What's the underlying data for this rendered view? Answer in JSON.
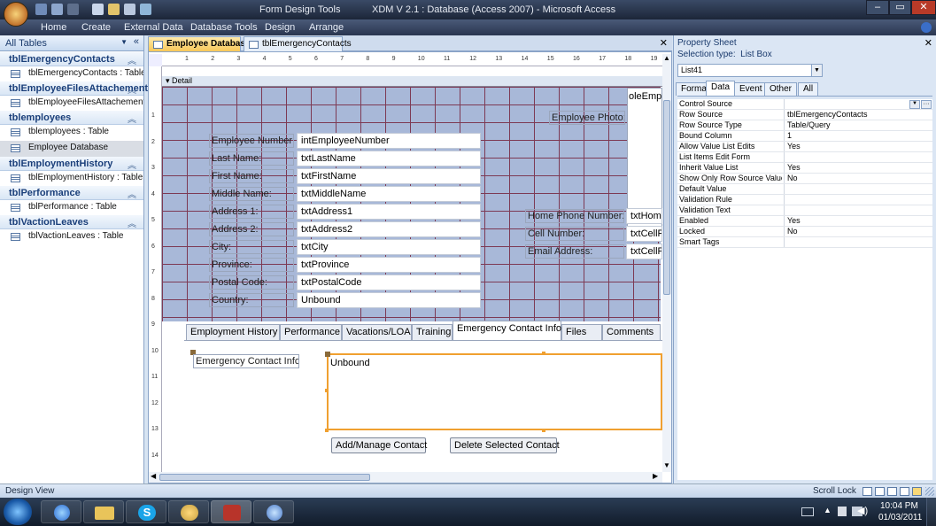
{
  "titlebar": {
    "context_title": "Form Design Tools",
    "title": "XDM V 2.1 : Database (Access 2007) - Microsoft Access",
    "min": "–",
    "max": "▭",
    "close": "✕"
  },
  "ribbon_tabs": [
    "Home",
    "Create",
    "External Data",
    "Database Tools",
    "Design",
    "Arrange"
  ],
  "nav": {
    "header": "All Tables",
    "groups": [
      {
        "name": "tblEmergencyContacts",
        "items": [
          "tblEmergencyContacts : Table"
        ]
      },
      {
        "name": "tblEmployeeFilesAttachement",
        "items": [
          "tblEmployeeFilesAttachement..."
        ]
      },
      {
        "name": "tblemployees",
        "items": [
          "tblemployees : Table",
          "Employee Database"
        ]
      },
      {
        "name": "tblEmploymentHistory",
        "items": [
          "tblEmploymentHistory : Table"
        ]
      },
      {
        "name": "tblPerformance",
        "items": [
          "tblPerformance : Table"
        ]
      },
      {
        "name": "tblVactionLeaves",
        "items": [
          "tblVactionLeaves : Table"
        ]
      }
    ]
  },
  "doc_tabs": [
    "Employee Database",
    "tblEmergencyContacts"
  ],
  "design": {
    "section": "Detail",
    "h_ruler": [
      "1",
      "2",
      "3",
      "4",
      "5",
      "6",
      "7",
      "8",
      "9",
      "10",
      "11",
      "12",
      "13",
      "14",
      "15",
      "16",
      "17",
      "18",
      "19"
    ],
    "v_ruler": [
      "1",
      "2",
      "3",
      "4",
      "5",
      "6",
      "7",
      "8",
      "9",
      "10",
      "11",
      "12",
      "13",
      "14"
    ],
    "fields": [
      {
        "label": "Employee Number:",
        "value": "intEmployeeNumber"
      },
      {
        "label": "Last Name:",
        "value": "txtLastName"
      },
      {
        "label": "First Name:",
        "value": "txtFirstName"
      },
      {
        "label": "Middle Name:",
        "value": "txtMiddleName"
      },
      {
        "label": "Address 1:",
        "value": "txtAddress1"
      },
      {
        "label": "Address 2:",
        "value": "txtAddress2"
      },
      {
        "label": "City:",
        "value": "txtCity"
      },
      {
        "label": "Province:",
        "value": "txtProvince"
      },
      {
        "label": "Postal Code:",
        "value": "txtPostalCode"
      },
      {
        "label": "Country:",
        "value": "Unbound"
      }
    ],
    "photo_label": "Employee Photo:",
    "photo_control": "oleEmpl",
    "right_fields": [
      {
        "label": "Home Phone Number:",
        "value": "txtHome"
      },
      {
        "label": "Cell Number:",
        "value": "txtCellP"
      },
      {
        "label": "Email Address:",
        "value": "txtCellP"
      }
    ],
    "form_tabs": [
      "Employment History",
      "Performance",
      "Vacations/LOA",
      "Training",
      "Emergency Contact Info",
      "Files",
      "Comments"
    ],
    "active_form_tab": "Emergency Contact Info",
    "ec_label": "Emergency Contact Info:",
    "listbox_value": "Unbound",
    "buttons": [
      "Add/Manage Contact",
      "Delete Selected Contact"
    ]
  },
  "property_sheet": {
    "title": "Property Sheet",
    "selection_type": "Selection type:  List Box",
    "selected_control": "List41",
    "tabs": [
      "Format",
      "Data",
      "Event",
      "Other",
      "All"
    ],
    "active_tab": "Data",
    "rows": [
      {
        "name": "Control Source",
        "value": ""
      },
      {
        "name": "Row Source",
        "value": "tblEmergencyContacts"
      },
      {
        "name": "Row Source Type",
        "value": "Table/Query"
      },
      {
        "name": "Bound Column",
        "value": "1"
      },
      {
        "name": "Allow Value List Edits",
        "value": "Yes"
      },
      {
        "name": "List Items Edit Form",
        "value": ""
      },
      {
        "name": "Inherit Value List",
        "value": "Yes"
      },
      {
        "name": "Show Only Row Source Values",
        "value": "No"
      },
      {
        "name": "Default Value",
        "value": ""
      },
      {
        "name": "Validation Rule",
        "value": ""
      },
      {
        "name": "Validation Text",
        "value": ""
      },
      {
        "name": "Enabled",
        "value": "Yes"
      },
      {
        "name": "Locked",
        "value": "No"
      },
      {
        "name": "Smart Tags",
        "value": ""
      }
    ]
  },
  "status": {
    "left": "Design View",
    "right": "Scroll Lock"
  },
  "taskbar": {
    "time": "10:04 PM",
    "date": "01/03/2011"
  },
  "colors": {
    "accent": "#f0a030",
    "grid_line": "#7d3a54",
    "grid_bg": "#a8b8d8"
  }
}
